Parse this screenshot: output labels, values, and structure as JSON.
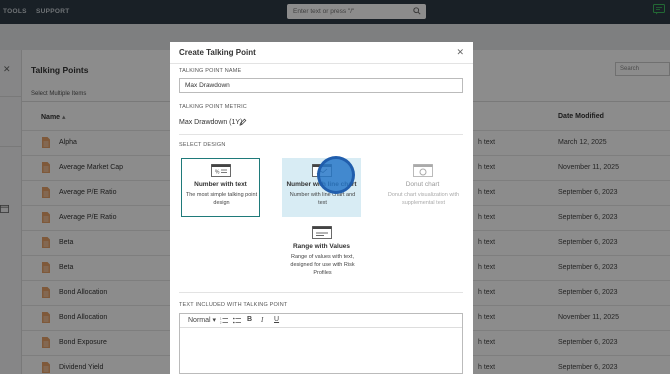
{
  "topbar": {
    "nav": [
      "TOOLS",
      "SUPPORT"
    ],
    "search_placeholder": "Enter text or press \"/\""
  },
  "page": {
    "title": "Talking Points",
    "select_multiple": "Select Multiple Items",
    "search_label": "Search",
    "columns": {
      "name": "Name",
      "date_modified": "Date Modified"
    }
  },
  "rows": [
    {
      "name": "Alpha",
      "frag": "h text",
      "date": "March 12, 2025"
    },
    {
      "name": "Average Market Cap",
      "frag": "h text",
      "date": "November 11, 2025"
    },
    {
      "name": "Average P/E Ratio",
      "frag": "h text",
      "date": "September 6, 2023"
    },
    {
      "name": "Average P/E Ratio",
      "frag": "h text",
      "date": "September 6, 2023"
    },
    {
      "name": "Beta",
      "frag": "h text",
      "date": "September 6, 2023"
    },
    {
      "name": "Beta",
      "frag": "h text",
      "date": "September 6, 2023"
    },
    {
      "name": "Bond Allocation",
      "frag": "h text",
      "date": "September 6, 2023"
    },
    {
      "name": "Bond Allocation",
      "frag": "h text",
      "date": "November 11, 2025"
    },
    {
      "name": "Bond Exposure",
      "frag": "h text",
      "date": "September 6, 2023"
    },
    {
      "name": "Dividend Yield",
      "frag": "h text",
      "date": "September 6, 2023"
    }
  ],
  "modal": {
    "title": "Create Talking Point",
    "name_label": "TALKING POINT NAME",
    "name_value": "Max Drawdown",
    "metric_label": "TALKING POINT METRIC",
    "metric_value": "Max Drawdown (1Y)",
    "design_label": "SELECT DESIGN",
    "designs": [
      {
        "title": "Number with text",
        "desc": "The most simple talking point design"
      },
      {
        "title": "Number with line chart",
        "desc": "Number with line chart and text"
      },
      {
        "title": "Donut chart",
        "desc": "Donut chart visualization with supplemental text"
      },
      {
        "title": "Range with Values",
        "desc": "Range of values with text, designed for use with Risk Profiles"
      }
    ],
    "text_label": "TEXT INCLUDED WITH TALKING POINT",
    "toolbar": {
      "format": "Normal",
      "bold": "B",
      "italic": "I",
      "underline": "U"
    }
  },
  "colors": {
    "topbar": "#2f3b46",
    "selected_border": "#1f7a7a",
    "hover_bg": "#d8ecf4",
    "doc_icon": "#e8a36a",
    "cursor": "#2878c8"
  }
}
